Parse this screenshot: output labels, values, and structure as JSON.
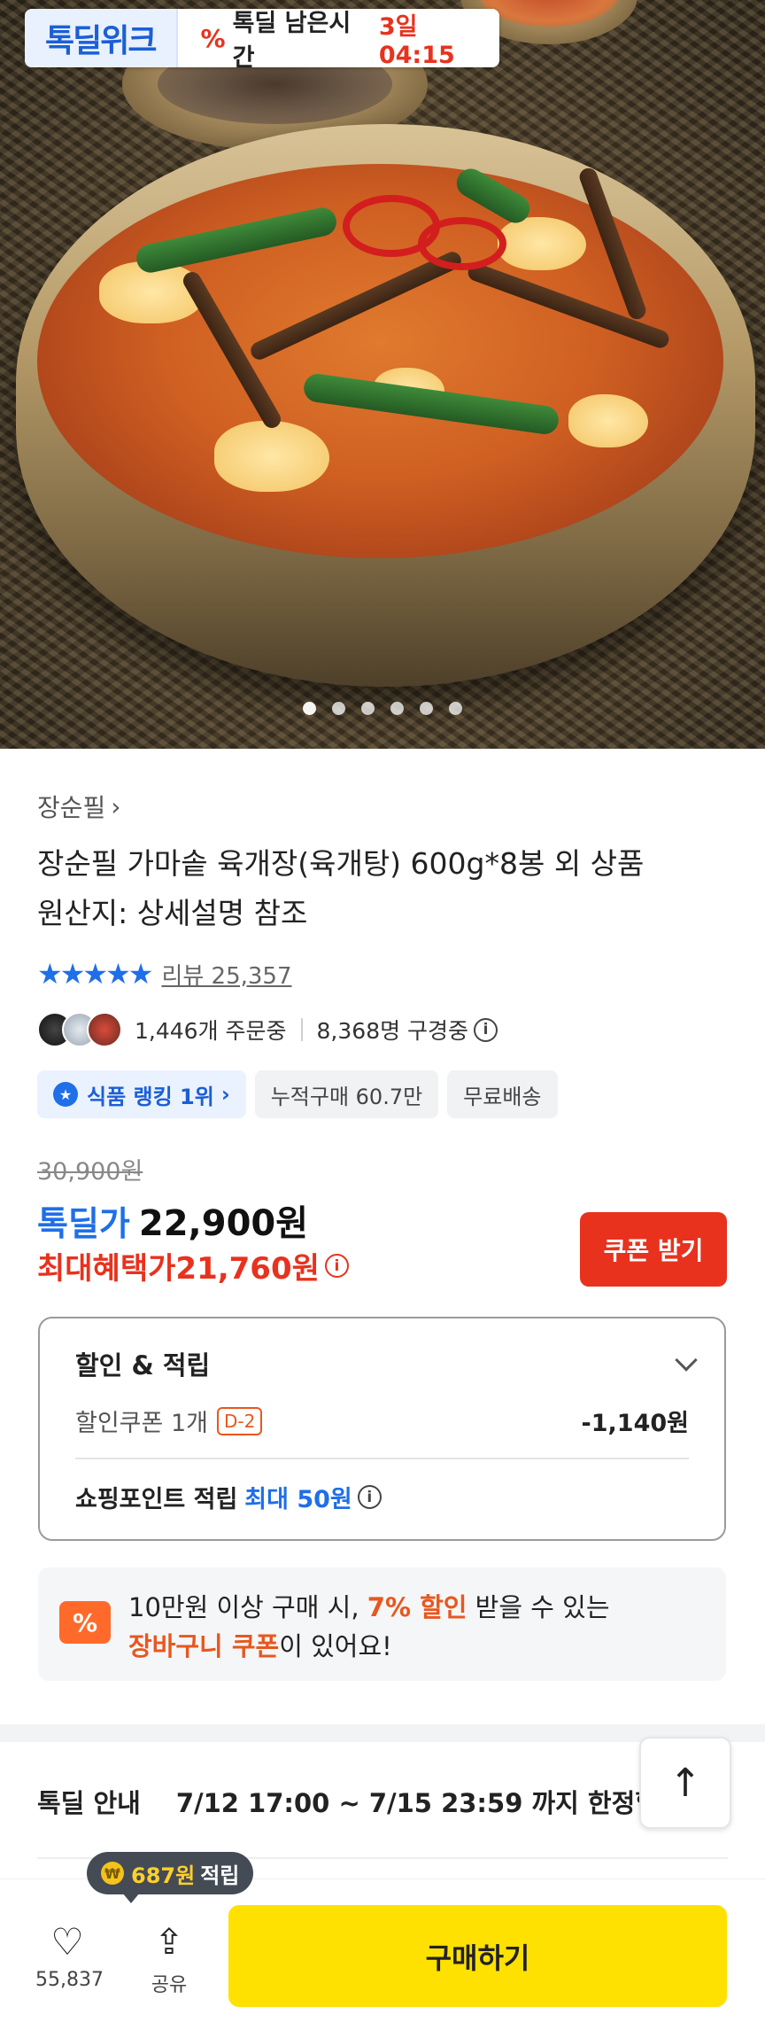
{
  "banner": {
    "brand": "톡딜위크",
    "percent_icon": "percent-icon",
    "remain_label": "톡딜 남은시간",
    "remain_time": "3일 04:15"
  },
  "hero": {
    "dots_total": 6,
    "active_dot": 1
  },
  "product": {
    "brand_link": "장순필",
    "title_line1": "장순필 가마솥 육개장(육개탕) 600g*8봉 외 상품",
    "title_line2": "원산지: 상세설명 참조",
    "stars": "★★★★★",
    "review_label": "리뷰 25,357",
    "orders": "1,446개 주문중",
    "viewing": "8,368명 구경중"
  },
  "chips": {
    "rank": "식품 랭킹 1위",
    "cumulative": "누적구매 60.7만",
    "shipping": "무료배송"
  },
  "price": {
    "original": "30,900원",
    "deal_label": "톡딜가",
    "deal_value": "22,900원",
    "max_label": "최대혜택가",
    "max_value": "21,760원",
    "coupon_button": "쿠폰 받기"
  },
  "benefits": {
    "title": "할인 & 적립",
    "coupon_label": "할인쿠폰 1개",
    "coupon_tag": "D-2",
    "coupon_discount": "-1,140원",
    "point_label": "쇼핑포인트 적립",
    "point_value": "최대 50원"
  },
  "cart_notice": {
    "icon": "%",
    "line1_pre": "10만원 이상 구매 시, ",
    "line1_hl": "7% 할인",
    "line1_post": " 받을 수 있는",
    "line2_hl": "장바구니 쿠폰",
    "line2_post": "이 있어요!"
  },
  "deal_info": {
    "label": "톡딜 안내",
    "period": "7/12 17:00 ~ 7/15 23:59 까지 한정할인"
  },
  "bottom": {
    "points_amount": "687원",
    "points_suffix": "적립",
    "like_count": "55,837",
    "share_label": "공유",
    "buy_label": "구매하기"
  },
  "colors": {
    "accent_blue": "#1e6fe8",
    "accent_red": "#e8321e",
    "buy_yellow": "#ffe100"
  }
}
